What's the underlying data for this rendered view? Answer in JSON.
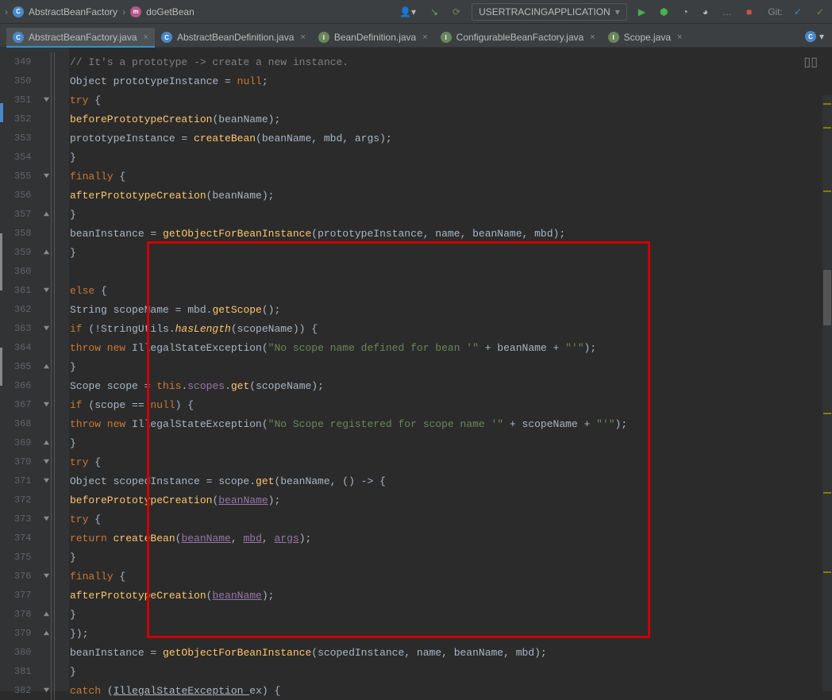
{
  "toolbar": {
    "crumb1": "AbstractBeanFactory",
    "crumb2": "doGetBean",
    "runconfig": "USERTRACINGAPPLICATION",
    "gitLabel": "Git:"
  },
  "tabs": {
    "t1": "AbstractBeanFactory.java",
    "t2": "AbstractBeanDefinition.java",
    "t3": "BeanDefinition.java",
    "t4": "ConfigurableBeanFactory.java",
    "t5": "Scope.java"
  },
  "lines": {
    "l349": "349",
    "l350": "350",
    "l351": "351",
    "l352": "352",
    "l353": "353",
    "l354": "354",
    "l355": "355",
    "l356": "356",
    "l357": "357",
    "l358": "358",
    "l359": "359",
    "l360": "360",
    "l361": "361",
    "l362": "362",
    "l363": "363",
    "l364": "364",
    "l365": "365",
    "l366": "366",
    "l367": "367",
    "l368": "368",
    "l369": "369",
    "l370": "370",
    "l371": "371",
    "l372": "372",
    "l373": "373",
    "l374": "374",
    "l375": "375",
    "l376": "376",
    "l377": "377",
    "l378": "378",
    "l379": "379",
    "l380": "380",
    "l381": "381",
    "l382": "382"
  },
  "code": {
    "c349": "// It's a prototype -> create a new instance.",
    "c350a": "Object prototypeInstance = ",
    "c350b": "null",
    "c350c": ";",
    "c351a": "try ",
    "c351b": "{",
    "c352a": "beforePrototypeCreation",
    "c352b": "(beanName);",
    "c353a": "prototypeInstance = ",
    "c353b": "createBean",
    "c353c": "(beanName, mbd, args);",
    "c354": "}",
    "c355a": "finally ",
    "c355b": "{",
    "c356a": "afterPrototypeCreation",
    "c356b": "(beanName);",
    "c357": "}",
    "c358a": "beanInstance = ",
    "c358b": "getObjectForBeanInstance",
    "c358c": "(prototypeInstance, name, beanName, mbd);",
    "c359": "}",
    "c360": "",
    "c361a": "else ",
    "c361b": "{",
    "c362a": "String scopeName = mbd.",
    "c362b": "getScope",
    "c362c": "();",
    "c363a": "if ",
    "c363b": "(!StringUtils.",
    "c363c": "hasLength",
    "c363d": "(scopeName)) {",
    "c364a": "throw new ",
    "c364b": "IllegalStateException",
    "c364c": "(",
    "c364d": "\"No scope name defined for bean '\"",
    "c364e": " + beanName + ",
    "c364f": "\"'\"",
    "c364g": ");",
    "c365": "}",
    "c366a": "Scope scope = ",
    "c366b": "this",
    "c366c": ".",
    "c366d": "scopes",
    "c366e": ".",
    "c366f": "get",
    "c366g": "(scopeName);",
    "c367a": "if ",
    "c367b": "(scope == ",
    "c367c": "null",
    "c367d": ") {",
    "c368a": "throw new ",
    "c368b": "IllegalStateException",
    "c368c": "(",
    "c368d": "\"No Scope registered for scope name '\"",
    "c368e": " + scopeName + ",
    "c368f": "\"'\"",
    "c368g": ");",
    "c369": "}",
    "c370a": "try ",
    "c370b": "{",
    "c371a": "Object scopedInstance = scope.",
    "c371b": "get",
    "c371c": "(beanName, () -> {",
    "c372a": "beforePrototypeCreation",
    "c372b": "(",
    "c372c": "beanName",
    "c372d": ");",
    "c373a": "try ",
    "c373b": "{",
    "c374a": "return ",
    "c374b": "createBean",
    "c374c": "(",
    "c374d": "beanName",
    "c374e": ", ",
    "c374f": "mbd",
    "c374g": ", ",
    "c374h": "args",
    "c374i": ");",
    "c375": "}",
    "c376a": "finally ",
    "c376b": "{",
    "c377a": "afterPrototypeCreation",
    "c377b": "(",
    "c377c": "beanName",
    "c377d": ");",
    "c378": "}",
    "c379": "});",
    "c380a": "beanInstance = ",
    "c380b": "getObjectForBeanInstance",
    "c380c": "(scopedInstance, name, beanName, mbd);",
    "c381": "}",
    "c382a": "catch ",
    "c382b": "(",
    "c382c": "IllegalStateException ",
    "c382d": "ex) {"
  }
}
